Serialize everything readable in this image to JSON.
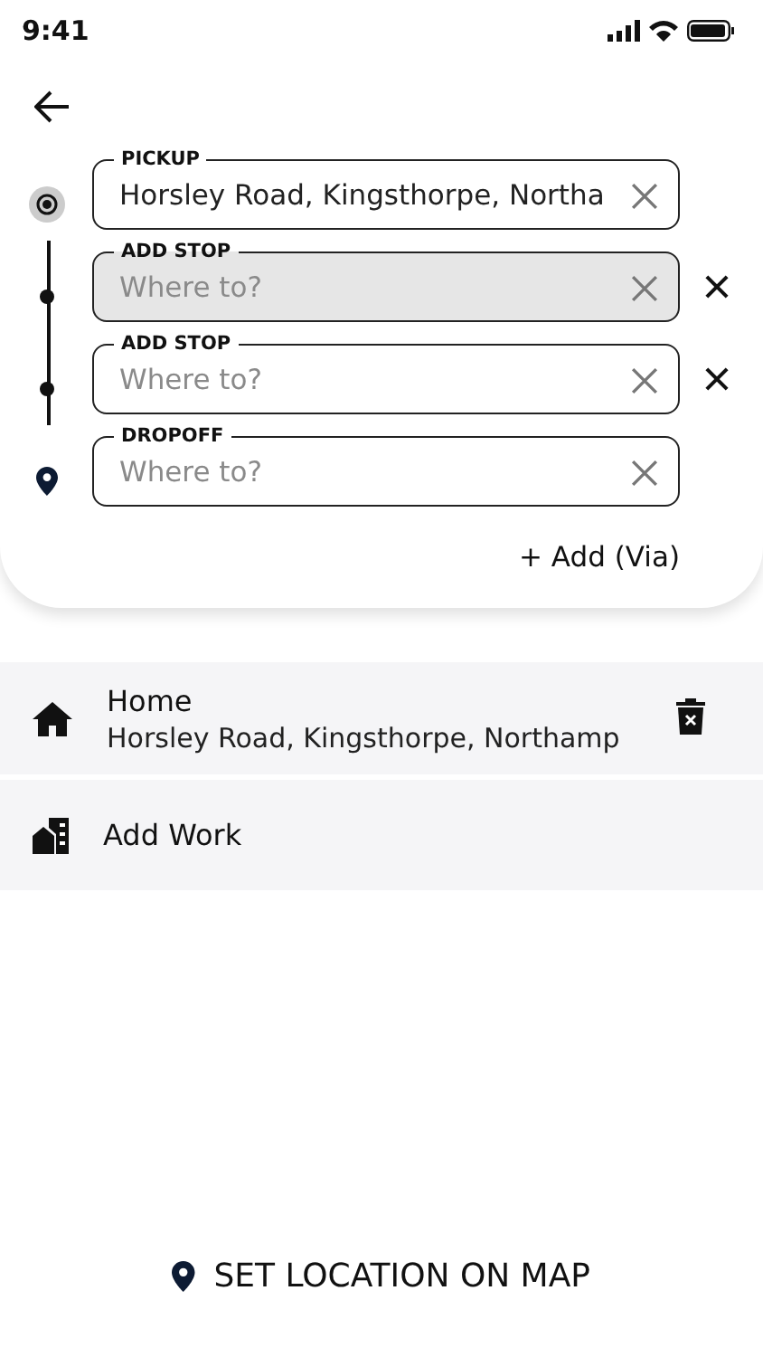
{
  "status_bar": {
    "time": "9:41"
  },
  "stops": [
    {
      "kind": "pickup",
      "label": "PICKUP",
      "value": "Horsley Road, Kingsthorpe, Northa",
      "focused": false,
      "removable": false
    },
    {
      "kind": "stop",
      "label": "ADD STOP",
      "placeholder": "Where to?",
      "focused": true,
      "removable": true
    },
    {
      "kind": "stop",
      "label": "ADD STOP",
      "placeholder": "Where to?",
      "focused": false,
      "removable": true
    },
    {
      "kind": "dropoff",
      "label": "DROPOFF",
      "placeholder": "Where to?",
      "focused": false,
      "removable": false
    }
  ],
  "add_via": "+ Add (Via)",
  "saved_places": [
    {
      "kind": "home",
      "title": "Home",
      "address": "Horsley Road, Kingsthorpe, Northamp",
      "deletable": true
    },
    {
      "kind": "work",
      "title": "Add Work",
      "deletable": false
    }
  ],
  "map_button": "SET LOCATION ON MAP"
}
